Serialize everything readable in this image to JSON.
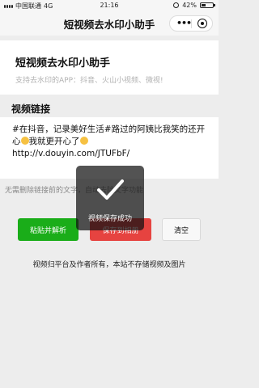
{
  "status_bar": {
    "carrier": "中国联通",
    "network": "4G",
    "time": "21:16",
    "battery": "42%",
    "battery_level": 0.42
  },
  "nav": {
    "title": "短视频去水印小助手",
    "more_icon": "more-dots-icon",
    "close_icon": "target-icon"
  },
  "header": {
    "title": "短视频去水印小助手",
    "subtitle": "支持去水印的APP：抖音、火山小视频、微视!"
  },
  "link_section": {
    "title": "视频链接",
    "content_part1": "#在抖音，记录美好生活#路过的阿姨比我笑的还开心",
    "content_part2": "我就更开心了",
    "content_part3": "http://v.douyin.com/JTUFbF/"
  },
  "hint": {
    "text": "无需删除链接前的文字，自动去除文字功能"
  },
  "buttons": {
    "parse": "粘贴并解析",
    "save": "保存到相册",
    "clear": "清空"
  },
  "footer": {
    "text": "视频归平台及作者所有，本站不存储视频及图片"
  },
  "toast": {
    "text": "视频保存成功",
    "icon": "checkmark-icon"
  }
}
